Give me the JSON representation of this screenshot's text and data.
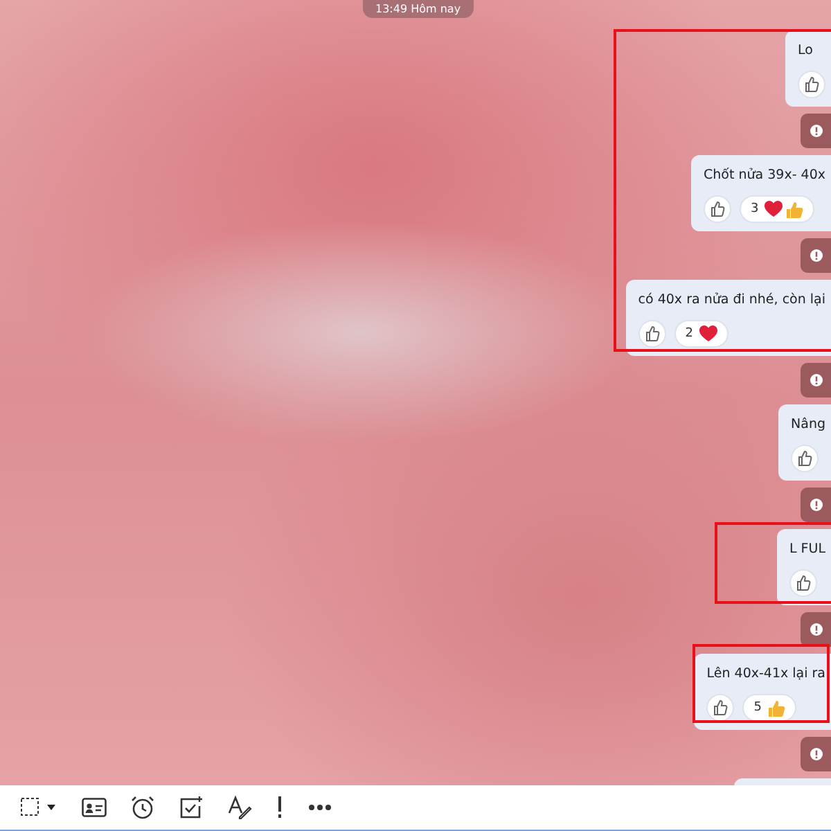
{
  "date_divider": "13:49 Hôm nay",
  "messages": [
    {
      "kind": "text",
      "text": "Lo"
    },
    {
      "kind": "notice"
    },
    {
      "kind": "text",
      "text": "Chốt nửa 39x- 40x",
      "reactions": [
        {
          "count": "3",
          "icons": [
            {
              "kind": "heart"
            },
            {
              "kind": "like"
            }
          ]
        }
      ]
    },
    {
      "kind": "notice"
    },
    {
      "kind": "text",
      "text": "có 40x ra nửa đi nhé, còn lại",
      "reactions": [
        {
          "count": "2",
          "icons": [
            {
              "kind": "heart"
            }
          ]
        }
      ]
    },
    {
      "kind": "notice"
    },
    {
      "kind": "text",
      "text": "Nâng"
    },
    {
      "kind": "notice"
    },
    {
      "kind": "text",
      "text": "L FUL"
    },
    {
      "kind": "notice"
    },
    {
      "kind": "text",
      "text": "Lên 40x-41x lại ra",
      "reactions": [
        {
          "count": "5",
          "icons": [
            {
              "kind": "like"
            }
          ]
        }
      ]
    },
    {
      "kind": "notice"
    },
    {
      "kind": "partial"
    }
  ]
}
